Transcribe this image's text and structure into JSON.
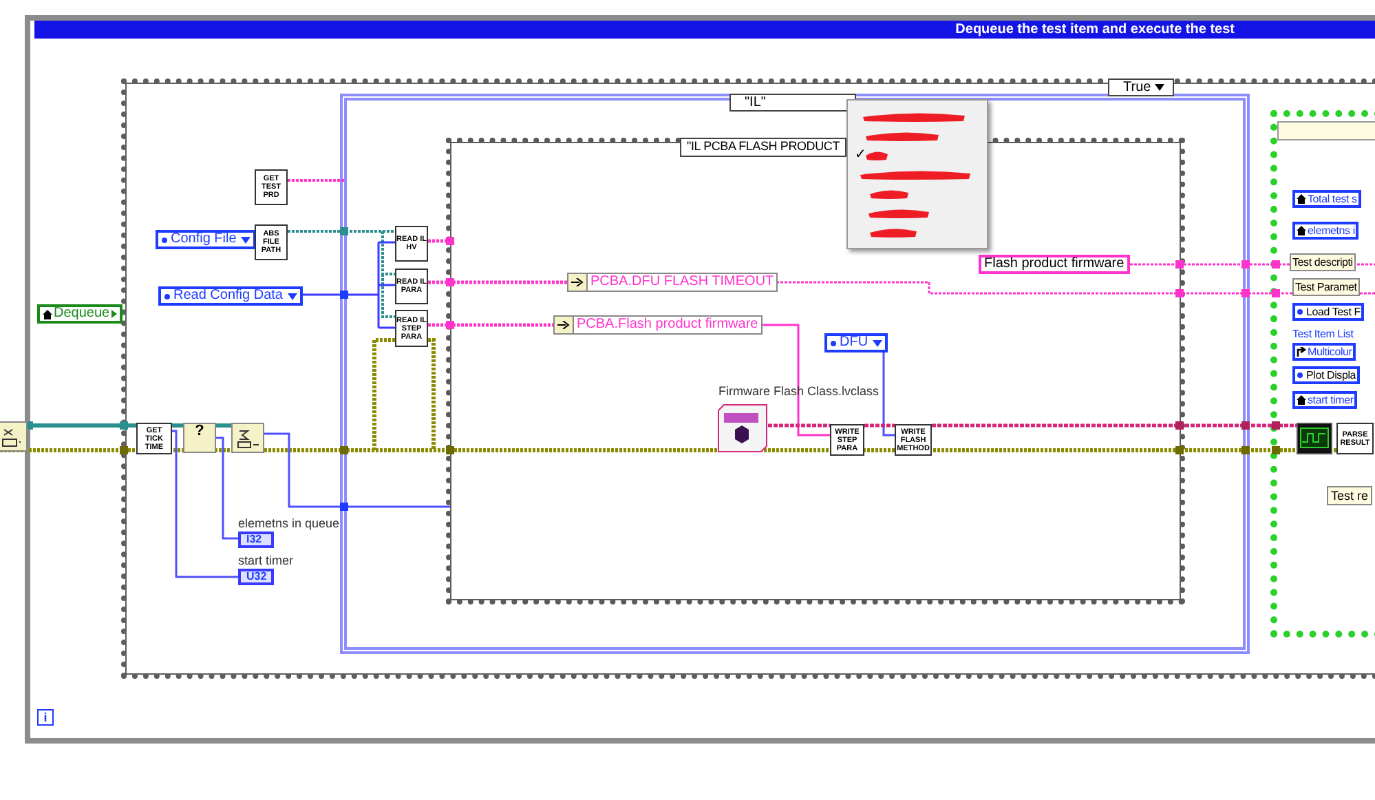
{
  "diagram_title": "Dequeue the test item and execute the test",
  "loop_iteration": "i",
  "outer_case": {
    "selector": "True"
  },
  "middle_case": {
    "selector": "\"IL\""
  },
  "inner_case": {
    "selector": "\"IL PCBA FLASH PRODUCT"
  },
  "case_menu": {
    "check_glyph": "✓",
    "items": [
      {
        "checked": false
      },
      {
        "checked": false
      },
      {
        "checked": true
      },
      {
        "checked": false
      },
      {
        "checked": false
      },
      {
        "checked": false
      },
      {
        "checked": false
      }
    ]
  },
  "local_variables": [
    {
      "label": "Dequeue"
    }
  ],
  "enum_constants": [
    {
      "label": "Config File"
    },
    {
      "label": "Read Config Data"
    },
    {
      "label": "DFU"
    }
  ],
  "subvis": [
    {
      "label": "GET TEST PRD"
    },
    {
      "label": "ABS FILE PATH"
    },
    {
      "label": "READ IL HV"
    },
    {
      "label": "READ IL PARA"
    },
    {
      "label": "READ IL STEP PARA"
    },
    {
      "label": "GET TICK TIME"
    },
    {
      "label": "WRITE STEP PARA"
    },
    {
      "label": "WRITE FLASH METHOD"
    },
    {
      "label": "PARSE RESULT"
    }
  ],
  "queue_nodes": [
    {
      "glyph": "?"
    }
  ],
  "unbundles": [
    {
      "label": "PCBA.DFU FLASH TIMEOUT"
    },
    {
      "label": "PCBA.Flash product firmware"
    }
  ],
  "string_constants": [
    {
      "label": "Flash product firmware"
    }
  ],
  "class_constant": {
    "label": "Firmware Flash Class.lvclass"
  },
  "indicators": [
    {
      "label": "elemetns in queue",
      "type": "I32"
    },
    {
      "label": "start timer",
      "type": "U32"
    }
  ],
  "right_terminals": [
    {
      "kind": "local",
      "label": "Total test s"
    },
    {
      "kind": "local",
      "label": "elemetns i"
    },
    {
      "kind": "bundle",
      "label": "Test descripti"
    },
    {
      "kind": "bundle",
      "label": "Test Paramet"
    },
    {
      "kind": "enum",
      "label": "Load Test F"
    },
    {
      "kind": "caption",
      "label": "Test Item List"
    },
    {
      "kind": "ref",
      "label": "Multicolur"
    },
    {
      "kind": "enum",
      "label": "Plot Displa"
    },
    {
      "kind": "local",
      "label": "start timer"
    }
  ],
  "test_result_label": "Test re"
}
